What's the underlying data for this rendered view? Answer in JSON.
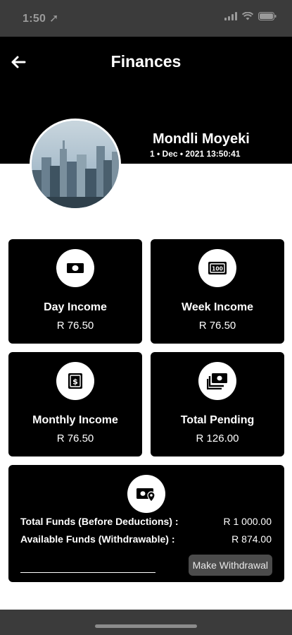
{
  "status_bar": {
    "time": "1:50"
  },
  "header": {
    "title": "Finances"
  },
  "profile": {
    "name": "Mondli Moyeki",
    "date": "1 • Dec • 2021  13:50:41"
  },
  "cards": [
    {
      "title": "Day Income",
      "value": "R 76.50",
      "icon": "cash-icon"
    },
    {
      "title": "Week Income",
      "value": "R 76.50",
      "icon": "banknote-100-icon"
    },
    {
      "title": "Monthly Income",
      "value": "R 76.50",
      "icon": "dollar-bill-icon"
    },
    {
      "title": "Total Pending",
      "value": "R 126.00",
      "icon": "stacked-cash-icon"
    }
  ],
  "funds": {
    "icon": "cash-location-icon",
    "total_label": "Total Funds (Before Deductions) :",
    "total_value": "R 1 000.00",
    "available_label": "Available Funds (Withdrawable) :",
    "available_value": "R 874.00",
    "withdraw_button": "Make Withdrawal"
  },
  "colors": {
    "background": "#ffffff",
    "card": "#000000",
    "status_bar": "#3b3b3b",
    "button": "#4b4b4b"
  }
}
